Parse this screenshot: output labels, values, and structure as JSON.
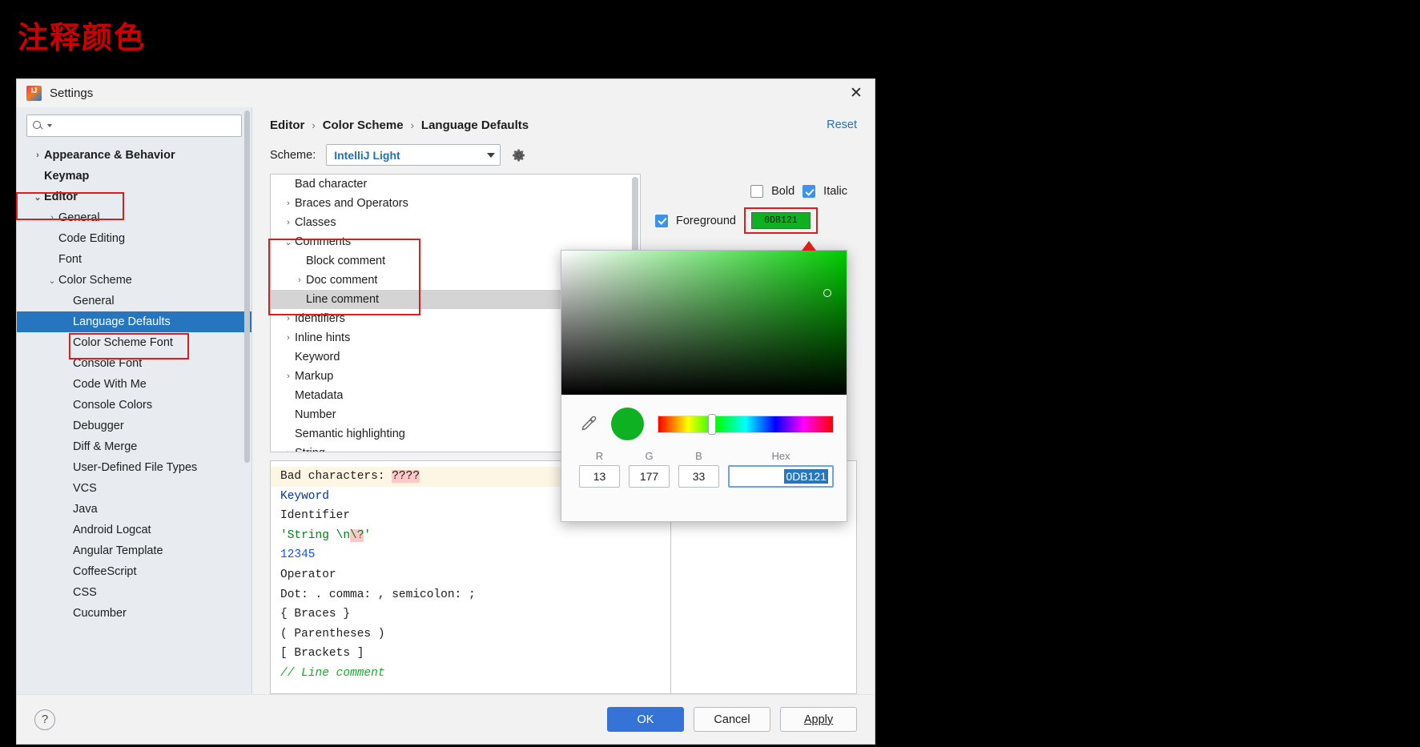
{
  "page": {
    "title": "注释颜色"
  },
  "dialog": {
    "title": "Settings",
    "close_icon": "close-icon",
    "logo_icon": "intellij-logo-icon"
  },
  "search": {
    "placeholder": "",
    "value": "",
    "icon": "search-icon"
  },
  "sidebar": {
    "items": [
      {
        "label": "Appearance & Behavior",
        "indent": 0,
        "chevron": "›",
        "bold": true,
        "selected": false
      },
      {
        "label": "Keymap",
        "indent": 0,
        "chevron": "",
        "bold": true,
        "selected": false
      },
      {
        "label": "Editor",
        "indent": 0,
        "chevron": "⌄",
        "bold": true,
        "selected": false
      },
      {
        "label": "General",
        "indent": 1,
        "chevron": "›",
        "bold": false,
        "selected": false
      },
      {
        "label": "Code Editing",
        "indent": 1,
        "chevron": "",
        "bold": false,
        "selected": false
      },
      {
        "label": "Font",
        "indent": 1,
        "chevron": "",
        "bold": false,
        "selected": false
      },
      {
        "label": "Color Scheme",
        "indent": 1,
        "chevron": "⌄",
        "bold": false,
        "selected": false
      },
      {
        "label": "General",
        "indent": 2,
        "chevron": "",
        "bold": false,
        "selected": false
      },
      {
        "label": "Language Defaults",
        "indent": 2,
        "chevron": "",
        "bold": false,
        "selected": true
      },
      {
        "label": "Color Scheme Font",
        "indent": 2,
        "chevron": "",
        "bold": false,
        "selected": false
      },
      {
        "label": "Console Font",
        "indent": 2,
        "chevron": "",
        "bold": false,
        "selected": false
      },
      {
        "label": "Code With Me",
        "indent": 2,
        "chevron": "",
        "bold": false,
        "selected": false
      },
      {
        "label": "Console Colors",
        "indent": 2,
        "chevron": "",
        "bold": false,
        "selected": false
      },
      {
        "label": "Debugger",
        "indent": 2,
        "chevron": "",
        "bold": false,
        "selected": false
      },
      {
        "label": "Diff & Merge",
        "indent": 2,
        "chevron": "",
        "bold": false,
        "selected": false
      },
      {
        "label": "User-Defined File Types",
        "indent": 2,
        "chevron": "",
        "bold": false,
        "selected": false
      },
      {
        "label": "VCS",
        "indent": 2,
        "chevron": "",
        "bold": false,
        "selected": false
      },
      {
        "label": "Java",
        "indent": 2,
        "chevron": "",
        "bold": false,
        "selected": false
      },
      {
        "label": "Android Logcat",
        "indent": 2,
        "chevron": "",
        "bold": false,
        "selected": false
      },
      {
        "label": "Angular Template",
        "indent": 2,
        "chevron": "",
        "bold": false,
        "selected": false
      },
      {
        "label": "CoffeeScript",
        "indent": 2,
        "chevron": "",
        "bold": false,
        "selected": false
      },
      {
        "label": "CSS",
        "indent": 2,
        "chevron": "",
        "bold": false,
        "selected": false
      },
      {
        "label": "Cucumber",
        "indent": 2,
        "chevron": "",
        "bold": false,
        "selected": false
      }
    ]
  },
  "breadcrumb": {
    "items": [
      "Editor",
      "Color Scheme",
      "Language Defaults"
    ],
    "separator": "›",
    "reset_label": "Reset"
  },
  "scheme": {
    "label": "Scheme:",
    "value": "IntelliJ Light",
    "gear_icon": "gear-icon",
    "caret_icon": "chevron-down-icon"
  },
  "color_tree": {
    "items": [
      {
        "label": "Bad character",
        "indent": 1,
        "chevron": "",
        "selected": false
      },
      {
        "label": "Braces and Operators",
        "indent": 1,
        "chevron": "›",
        "selected": false
      },
      {
        "label": "Classes",
        "indent": 1,
        "chevron": "›",
        "selected": false
      },
      {
        "label": "Comments",
        "indent": 1,
        "chevron": "⌄",
        "selected": false
      },
      {
        "label": "Block comment",
        "indent": 2,
        "chevron": "",
        "selected": false
      },
      {
        "label": "Doc comment",
        "indent": 2,
        "chevron": "›",
        "selected": false
      },
      {
        "label": "Line comment",
        "indent": 2,
        "chevron": "",
        "selected": true
      },
      {
        "label": "Identifiers",
        "indent": 1,
        "chevron": "›",
        "selected": false
      },
      {
        "label": "Inline hints",
        "indent": 1,
        "chevron": "›",
        "selected": false
      },
      {
        "label": "Keyword",
        "indent": 1,
        "chevron": "",
        "selected": false
      },
      {
        "label": "Markup",
        "indent": 1,
        "chevron": "›",
        "selected": false
      },
      {
        "label": "Metadata",
        "indent": 1,
        "chevron": "",
        "selected": false
      },
      {
        "label": "Number",
        "indent": 1,
        "chevron": "",
        "selected": false
      },
      {
        "label": "Semantic highlighting",
        "indent": 1,
        "chevron": "",
        "selected": false
      },
      {
        "label": "String",
        "indent": 1,
        "chevron": "›",
        "selected": false
      }
    ]
  },
  "attributes": {
    "bold_label": "Bold",
    "bold_checked": false,
    "italic_label": "Italic",
    "italic_checked": true,
    "foreground_label": "Foreground",
    "foreground_checked": true,
    "foreground_color": "#0DB121",
    "foreground_swatch_text": "0DB121"
  },
  "preview": {
    "lines": [
      {
        "text": "Bad characters: ????",
        "highlight": true
      },
      {
        "text": "Keyword"
      },
      {
        "text": "Identifier"
      },
      {
        "text": "'String \\n\\?'"
      },
      {
        "text": "12345"
      },
      {
        "text": "Operator"
      },
      {
        "text": "Dot: . comma: , semicolon: ;"
      },
      {
        "text": "{ Braces }"
      },
      {
        "text": "( Parentheses )"
      },
      {
        "text": "[ Brackets ]"
      },
      {
        "text": "// Line comment"
      }
    ]
  },
  "picker": {
    "eyedropper_icon": "eyedropper-icon",
    "preview_color": "#0DB121",
    "r_label": "R",
    "g_label": "G",
    "b_label": "B",
    "hex_label": "Hex",
    "r_value": "13",
    "g_value": "177",
    "b_value": "33",
    "hex_value": "0DB121"
  },
  "footer": {
    "help_icon": "help-icon",
    "ok_label": "OK",
    "cancel_label": "Cancel",
    "apply_label": "Apply"
  }
}
